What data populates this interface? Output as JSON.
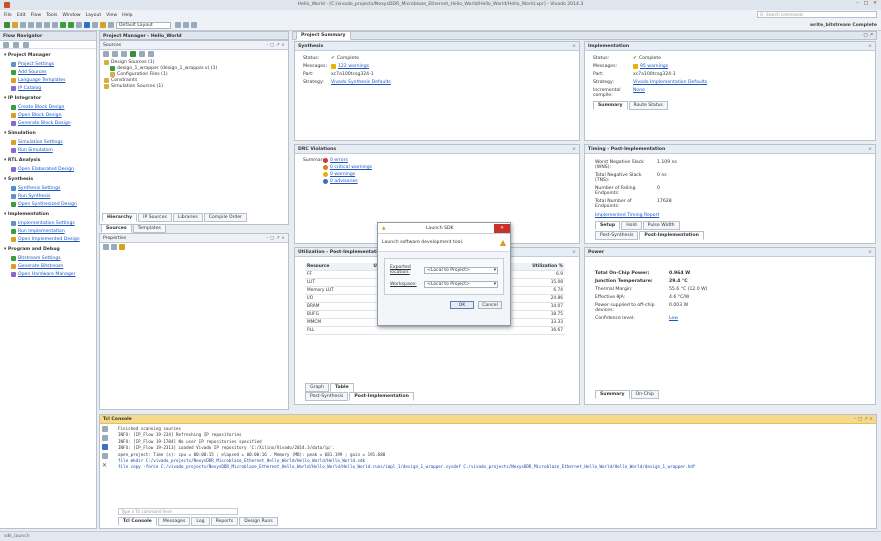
{
  "title": "Hello_World - [C:/vivado_projects/NexysDDR_Microblaze_Ethernet_Hello_World/Hello_World/Hello_World.xpr] - Vivado 2014.3",
  "menu": [
    "File",
    "Edit",
    "Flow",
    "Tools",
    "Window",
    "Layout",
    "View",
    "Help"
  ],
  "toolbar": {
    "layout_select": "Default Layout",
    "search_placeholder": "Q- Search commands",
    "ready_label": "write_bitstream Complete"
  },
  "flow_nav": {
    "title": "Flow Navigator",
    "sections": [
      {
        "label": "Project Manager",
        "items": [
          "Project Settings",
          "Add Sources",
          "Language Templates",
          "IP Catalog"
        ]
      },
      {
        "label": "IP Integrator",
        "items": [
          "Create Block Design",
          "Open Block Design",
          "Generate Block Design"
        ]
      },
      {
        "label": "Simulation",
        "items": [
          "Simulation Settings",
          "Run Simulation"
        ]
      },
      {
        "label": "RTL Analysis",
        "items": [
          "Open Elaborated Design"
        ]
      },
      {
        "label": "Synthesis",
        "items": [
          "Synthesis Settings",
          "Run Synthesis",
          "Open Synthesized Design"
        ]
      },
      {
        "label": "Implementation",
        "items": [
          "Implementation Settings",
          "Run Implementation",
          "Open Implemented Design"
        ]
      },
      {
        "label": "Program and Debug",
        "items": [
          "Bitstream Settings",
          "Generate Bitstream",
          "Open Hardware Manager"
        ]
      }
    ]
  },
  "pm": {
    "title": "Project Manager - Hello_World",
    "sources_title": "Sources",
    "tree": [
      "Design Sources (1)",
      "design_1_wrapper (design_1_wrapper.v) (1)",
      "Configuration Files (1)",
      "Constraints",
      "Simulation Sources (1)"
    ],
    "tabs": [
      "Hierarchy",
      "IP Sources",
      "Libraries",
      "Compile Order"
    ],
    "sub_tabs": [
      "Sources",
      "Templates"
    ],
    "properties_title": "Properties"
  },
  "summary": {
    "tab": "Project Summary",
    "synthesis": {
      "title": "Synthesis",
      "status_k": "Status:",
      "status_v": "Complete",
      "msg_k": "Messages:",
      "msg_v": "122 warnings",
      "part_k": "Part:",
      "part_v": "xc7a100tcsg324-1",
      "strat_k": "Strategy:",
      "strat_v": "Vivado Synthesis Defaults"
    },
    "implementation": {
      "title": "Implementation",
      "status_k": "Status:",
      "status_v": "Complete",
      "msg_k": "Messages:",
      "msg_v": "95 warnings",
      "part_k": "Part:",
      "part_v": "xc7a100tcsg324-1",
      "strat_k": "Strategy:",
      "strat_v": "Vivado Implementation Defaults",
      "incr_k": "Incremental compile:",
      "incr_v": "None",
      "tabs": [
        "Summary",
        "Route Status"
      ]
    },
    "drc": {
      "title": "DRC Violations",
      "sum_k": "Summary:",
      "items": [
        "0 errors",
        "0 critical warnings",
        "0 warnings",
        "0 advisories"
      ]
    },
    "timing": {
      "title": "Timing - Post-Implementation",
      "rows": [
        [
          "Worst Negative Slack (WNS):",
          "1.109 ns"
        ],
        [
          "Total Negative Slack (TNS):",
          "0 ns"
        ],
        [
          "Number of Failing Endpoints:",
          "0"
        ],
        [
          "Total Number of Endpoints:",
          "17628"
        ]
      ],
      "link": "Implemented Timing Report",
      "tabs": [
        "Setup",
        "Hold",
        "Pulse Width"
      ],
      "sub_tabs": [
        "Post-Synthesis",
        "Post-Implementation"
      ]
    },
    "util": {
      "title": "Utilization - Post-Implementation",
      "cols": [
        "Resource",
        "Utilization",
        "Available",
        "Utilization %"
      ],
      "rows": [
        [
          "FF",
          "",
          "",
          "6.9"
        ],
        [
          "LUT",
          "",
          "",
          "15.08"
        ],
        [
          "Memory LUT",
          "",
          "",
          "6.74"
        ],
        [
          "I/O",
          "",
          "",
          "24.86"
        ],
        [
          "BRAM",
          "",
          "",
          "14.07"
        ],
        [
          "BUFG",
          "",
          "",
          "18.75"
        ],
        [
          "MMCM",
          "",
          "",
          "33.33"
        ],
        [
          "PLL",
          "",
          "",
          "16.67"
        ]
      ],
      "tabs": [
        "Graph",
        "Table"
      ],
      "sub_tabs": [
        "Post-Synthesis",
        "Post-Implementation"
      ]
    },
    "power": {
      "title": "Power",
      "rows": [
        [
          "Total On-Chip Power:",
          "0.964 W"
        ],
        [
          "Junction Temperature:",
          "29.4 °C"
        ],
        [
          "Thermal Margin:",
          "55.6 °C (12.0 W)"
        ],
        [
          "Effective θJA:",
          "4.6 °C/W"
        ],
        [
          "Power supplied to off-chip devices:",
          "0.003 W"
        ],
        [
          "Confidence level:",
          "Low"
        ]
      ],
      "tabs": [
        "Summary",
        "On-Chip"
      ]
    }
  },
  "dialog": {
    "title": "Launch SDK",
    "desc": "Launch software development tool.",
    "exported_k": "Exported location:",
    "exported_v": "<Local to Project>",
    "workspace_k": "Workspace:",
    "workspace_v": "<Local to Project>",
    "ok": "OK",
    "cancel": "Cancel"
  },
  "console": {
    "title": "Tcl Console",
    "lines": [
      "Finished scanning sources",
      "INFO: [IP_Flow 19-234] Refreshing IP repositories",
      "INFO: [IP_Flow 19-1704] No user IP repositories specified",
      "INFO: [IP_Flow 19-2313] Loaded Vivado IP repository 'C:/Xilinx/Vivado/2014.3/data/ip'.",
      "open_project: Time (s): cpu = 00:00:15 ; elapsed = 00:00:16 . Memory (MB): peak = 681.199 ; gain = 191.680",
      "file mkdir C:/vivado_projects/NexysDDR_Microblaze_Ethernet_Hello_World/Hello_World/Hello_World.sdk",
      "file copy -force C:/vivado_projects/NexysDDR_Microblaze_Ethernet_Hello_World/Hello_World/Hello_World.runs/impl_1/design_1_wrapper.sysdef C:/vivado_projects/NexysDDR_Microblaze_Ethernet_Hello_World/Hello_World/design_1_wrapper.hdf"
    ],
    "input_placeholder": "Type a Tcl command here",
    "tabs": [
      "Tcl Console",
      "Messages",
      "Log",
      "Reports",
      "Design Runs"
    ]
  },
  "status": "sdk_launch"
}
